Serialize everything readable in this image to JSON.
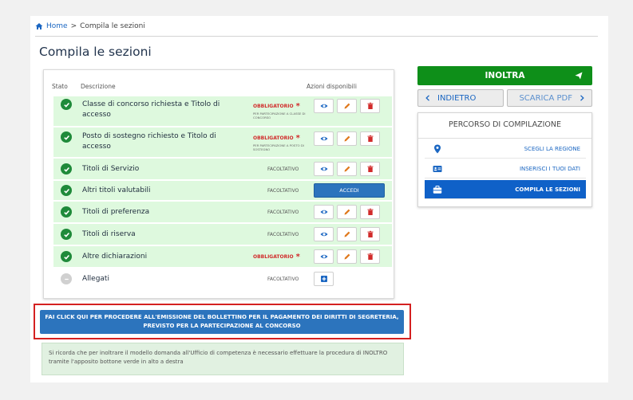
{
  "breadcrumb": {
    "home": "Home",
    "separator": ">",
    "current": "Compila le sezioni"
  },
  "page_title": "Compila le sezioni",
  "table": {
    "headers": {
      "stato": "Stato",
      "descrizione": "Descrizione",
      "azioni": "Azioni disponibili"
    },
    "rows": [
      {
        "label": "Classe di concorso richiesta e Titolo di accesso",
        "status": "complete",
        "requirement": "OBBLIGATORIO",
        "star": "*",
        "note": "PER PARTECIPAZIONE A CLASSE DI CONCORSO",
        "actions": [
          "view",
          "edit",
          "delete"
        ]
      },
      {
        "label": "Posto di sostegno richiesto e Titolo di accesso",
        "status": "complete",
        "requirement": "OBBLIGATORIO",
        "star": "*",
        "note": "PER PARTECIPAZIONE A POSTO DI SOSTEGNO",
        "actions": [
          "view",
          "edit",
          "delete"
        ]
      },
      {
        "label": "Titoli di Servizio",
        "status": "complete",
        "requirement": "FACOLTATIVO",
        "actions": [
          "view",
          "edit",
          "delete"
        ]
      },
      {
        "label": "Altri titoli valutabili",
        "status": "complete",
        "requirement": "FACOLTATIVO",
        "actions": [
          "accedi"
        ],
        "accedi_label": "ACCEDI"
      },
      {
        "label": "Titoli di preferenza",
        "status": "complete",
        "requirement": "FACOLTATIVO",
        "actions": [
          "view",
          "edit",
          "delete"
        ]
      },
      {
        "label": "Titoli di riserva",
        "status": "complete",
        "requirement": "FACOLTATIVO",
        "actions": [
          "view",
          "edit",
          "delete"
        ]
      },
      {
        "label": "Altre dichiarazioni",
        "status": "complete",
        "requirement": "OBBLIGATORIO",
        "star": "*",
        "actions": [
          "view",
          "edit",
          "delete"
        ]
      },
      {
        "label": "Allegati",
        "status": "empty",
        "requirement": "FACOLTATIVO",
        "actions": [
          "add"
        ]
      }
    ]
  },
  "payment_button": "FAI CLICK QUI PER PROCEDERE ALL'EMISSIONE DEL BOLLETTINO PER IL PAGAMENTO DEI DIRITTI DI SEGRETERIA, PREVISTO PER LA PARTECIPAZIONE AL CONCORSO",
  "note": "Si ricorda che per inoltrare il modello domanda all'Ufficio di competenza è necessario effettuare la procedura di INOLTRO tramite l'apposito bottone verde in alto a destra",
  "sidebar": {
    "inoltra_label": "INOLTRA",
    "indietro_label": "INDIETRO",
    "scarica_label": "SCARICA PDF",
    "percorso_title": "PERCORSO DI COMPILAZIONE",
    "steps": [
      {
        "label": "SCEGLI LA REGIONE",
        "icon": "map-marker-icon",
        "active": false
      },
      {
        "label": "INSERISCI I TUOI DATI",
        "icon": "id-card-icon",
        "active": false
      },
      {
        "label": "COMPILA LE SEZIONI",
        "icon": "briefcase-icon",
        "active": true
      }
    ]
  },
  "colors": {
    "primary_blue": "#2c74bd",
    "success_green": "#0e8f19",
    "row_green": "#def9de",
    "required_red": "#d12b2b",
    "highlight_red": "#d42020"
  }
}
